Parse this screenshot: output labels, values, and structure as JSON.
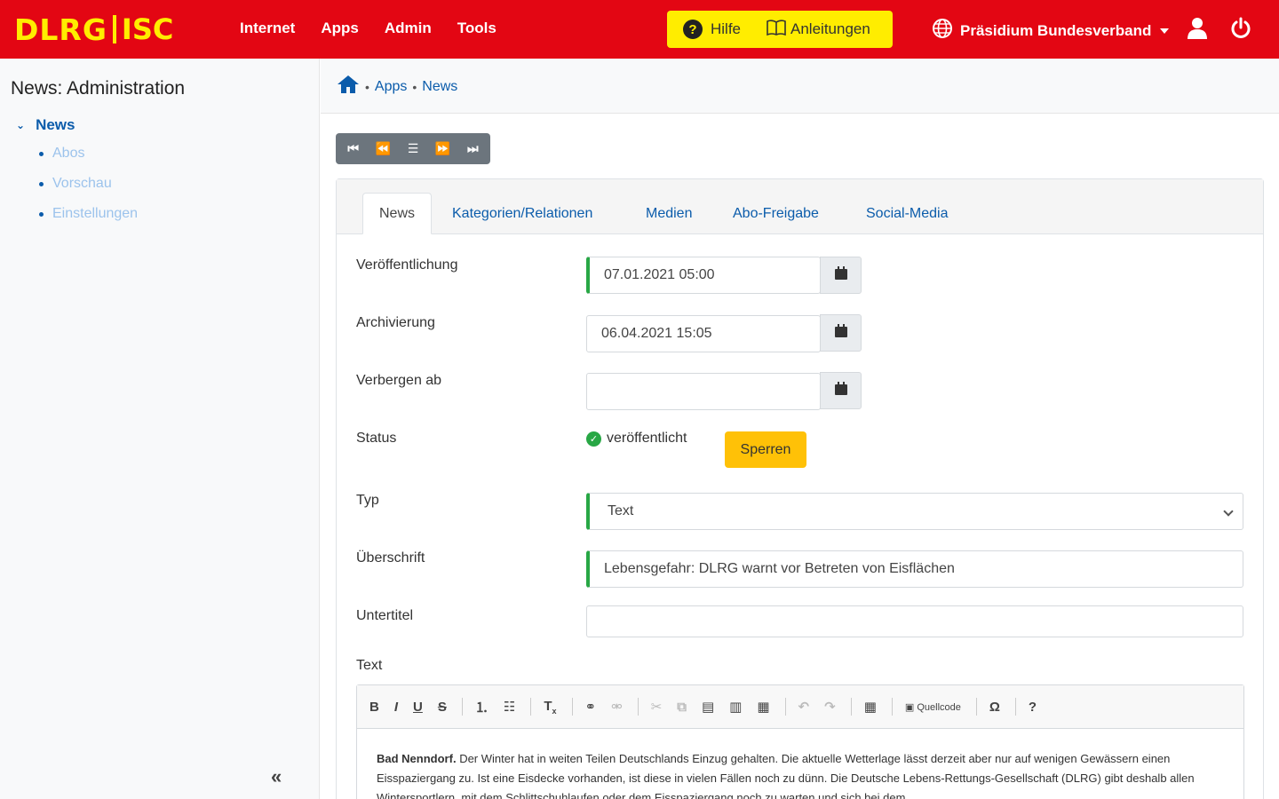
{
  "header": {
    "logo_text": "DLRG",
    "logo_suffix": "ISC",
    "nav": [
      "Internet",
      "Apps",
      "Admin",
      "Tools"
    ],
    "help_label": "Hilfe",
    "guides_label": "Anleitungen",
    "org_label": "Präsidium Bundesverband"
  },
  "sidebar": {
    "title": "News: Administration",
    "section": "News",
    "items": [
      "Abos",
      "Vorschau",
      "Einstellungen"
    ],
    "collapse_glyph": "«"
  },
  "breadcrumb": {
    "items": [
      "Apps",
      "News"
    ]
  },
  "pager": [
    "⏮",
    "⏪",
    "☰",
    "⏩",
    "⏭"
  ],
  "tabs": [
    "News",
    "Kategorien/Relationen",
    "Medien",
    "Abo-Freigabe",
    "Social-Media"
  ],
  "form": {
    "publish_label": "Veröffentlichung",
    "publish_value": "07.01.2021 05:00",
    "archive_label": "Archivierung",
    "archive_value": "06.04.2021 15:05",
    "hide_label": "Verbergen ab",
    "hide_value": "",
    "status_label": "Status",
    "status_value": "veröffentlicht",
    "lock_button": "Sperren",
    "type_label": "Typ",
    "type_value": "Text",
    "headline_label": "Überschrift",
    "headline_value": "Lebensgefahr: DLRG warnt vor Betreten von Eisflächen",
    "subtitle_label": "Untertitel",
    "subtitle_value": "",
    "text_label": "Text"
  },
  "editor": {
    "source_label": "Quellcode",
    "lead_bold": "Bad Nenndorf.",
    "body": "Der Winter hat in weiten Teilen Deutschlands Einzug gehalten. Die aktuelle Wetterlage lässt derzeit aber nur auf wenigen Gewässern einen Eisspaziergang zu. Ist eine Eisdecke vorhanden, ist diese in vielen Fällen noch zu dünn. Die Deutsche Lebens-Rettungs-Gesellschaft (DLRG) gibt deshalb allen Wintersportlern, mit dem Schlittschuhlaufen oder dem Eisspaziergang noch zu warten und sich bei dem"
  },
  "colors": {
    "brand_red": "#e30613",
    "brand_yellow": "#ffed00",
    "link_blue": "#0b5cab",
    "valid_green": "#28a745",
    "warning_yellow": "#ffc107"
  }
}
